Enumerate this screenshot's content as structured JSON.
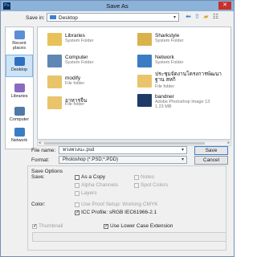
{
  "app_icon": "Ps",
  "window": {
    "title": "Save As",
    "close_symbol": "✕"
  },
  "toolbar": {
    "save_in_label": "Save in:",
    "save_in_value": "Desktop"
  },
  "places": [
    {
      "label": "Recent places",
      "icon": "recent-places-icon",
      "color": "#5b8fd6"
    },
    {
      "label": "Desktop",
      "icon": "desktop-icon",
      "color": "#2f6fc0"
    },
    {
      "label": "Libraries",
      "icon": "libraries-icon",
      "color": "#8a6bbf"
    },
    {
      "label": "Computer",
      "icon": "computer-icon",
      "color": "#4f79a8"
    },
    {
      "label": "Network",
      "icon": "network-icon",
      "color": "#3b7dc4"
    }
  ],
  "files": [
    {
      "name": "Libraries",
      "type": "System Folder",
      "size": "",
      "icon": "libraries-folder-icon",
      "color": "#e8c15a"
    },
    {
      "name": "Sharkstyle",
      "type": "System Folder",
      "size": "",
      "icon": "user-folder-icon",
      "color": "#d9b24c"
    },
    {
      "name": "Computer",
      "type": "System Folder",
      "size": "",
      "icon": "computer-icon",
      "color": "#5f86b4"
    },
    {
      "name": "Network",
      "type": "System Folder",
      "size": "",
      "icon": "network-icon",
      "color": "#3b7dc4"
    },
    {
      "name": "modify",
      "type": "File folder",
      "size": "",
      "icon": "folder-icon",
      "color": "#e9c46a"
    },
    {
      "name": "ประชุมจัดงานโครงการพัฒนาฐาน สหกิ",
      "type": "File folder",
      "size": "",
      "icon": "folder-icon",
      "color": "#e9c46a"
    },
    {
      "name": "อาหารจีน",
      "type": "File folder",
      "size": "",
      "icon": "folder-icon",
      "color": "#e9c46a"
    },
    {
      "name": "bandner",
      "type": "Adobe Photoshop Image 13",
      "size": "1.23 MB",
      "icon": "photoshop-file-icon",
      "color": "#1f3b66"
    }
  ],
  "filename": {
    "label": "File name:",
    "value": "พวงพวงนะ.psd"
  },
  "format": {
    "label": "Format:",
    "value": "Photoshop (*.PSD;*.PDD)"
  },
  "buttons": {
    "save": "Save",
    "cancel": "Cancel"
  },
  "save_options": {
    "title": "Save Options",
    "save_label": "Save:",
    "as_copy": "As a Copy",
    "notes": "Notes",
    "alpha_channels": "Alpha Channels",
    "spot_colors": "Spot Colors",
    "layers": "Layers",
    "color_label": "Color:",
    "use_proof_setup": "Use Proof Setup:  Working CMYK",
    "icc_profile": "ICC Profile:  sRGB IEC61966-2.1",
    "thumbnail": "Thumbnail",
    "lower_case": "Use Lower Case Extension",
    "check_mark": "✓"
  }
}
